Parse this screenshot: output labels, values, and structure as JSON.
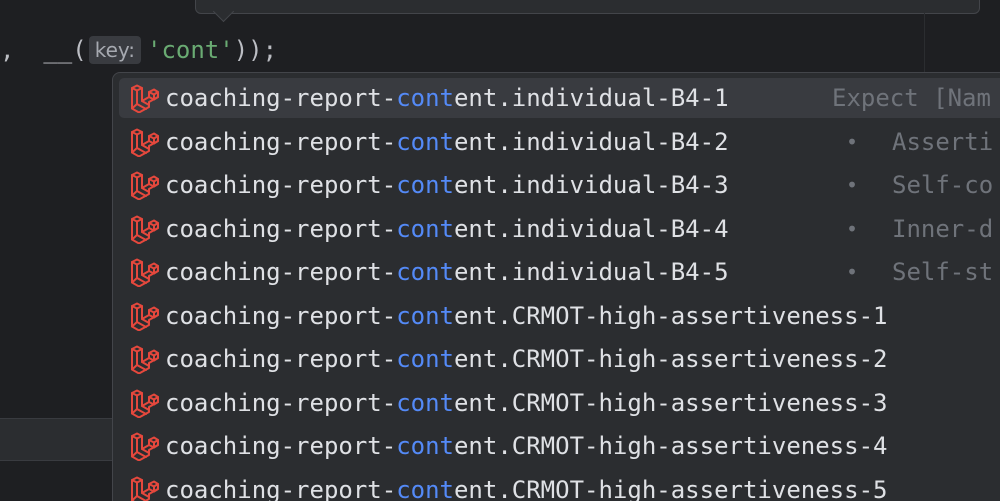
{
  "editor": {
    "code": {
      "prefix": ",  __(",
      "hint_label": "key:",
      "argument": "'cont'",
      "suffix": "));"
    }
  },
  "completion": {
    "match_text": "cont",
    "items": [
      {
        "before": "coaching-report-",
        "after": "ent.individual-B4-1",
        "selected": true,
        "hint": "Expect [Nam",
        "bullet": ""
      },
      {
        "before": "coaching-report-",
        "after": "ent.individual-B4-2",
        "selected": false,
        "hint": "Asserti",
        "bullet": "•"
      },
      {
        "before": "coaching-report-",
        "after": "ent.individual-B4-3",
        "selected": false,
        "hint": "Self-co",
        "bullet": "•"
      },
      {
        "before": "coaching-report-",
        "after": "ent.individual-B4-4",
        "selected": false,
        "hint": "Inner-d",
        "bullet": "•"
      },
      {
        "before": "coaching-report-",
        "after": "ent.individual-B4-5",
        "selected": false,
        "hint": "Self-st",
        "bullet": "•"
      },
      {
        "before": "coaching-report-",
        "after": "ent.CRMOT-high-assertiveness-1",
        "selected": false,
        "hint": "",
        "bullet": ""
      },
      {
        "before": "coaching-report-",
        "after": "ent.CRMOT-high-assertiveness-2",
        "selected": false,
        "hint": "",
        "bullet": ""
      },
      {
        "before": "coaching-report-",
        "after": "ent.CRMOT-high-assertiveness-3",
        "selected": false,
        "hint": "",
        "bullet": ""
      },
      {
        "before": "coaching-report-",
        "after": "ent.CRMOT-high-assertiveness-4",
        "selected": false,
        "hint": "",
        "bullet": ""
      },
      {
        "before": "coaching-report-",
        "after": "ent.CRMOT-high-assertiveness-5",
        "selected": false,
        "hint": "",
        "bullet": ""
      }
    ],
    "item_icon": "laravel-icon"
  },
  "colors": {
    "background": "#1e1f22",
    "popup": "#2b2d30",
    "selected_row": "#393b40",
    "match": "#548af7",
    "hint_text": "#6f737a",
    "string": "#6aab73",
    "icon": "#e5483d"
  }
}
